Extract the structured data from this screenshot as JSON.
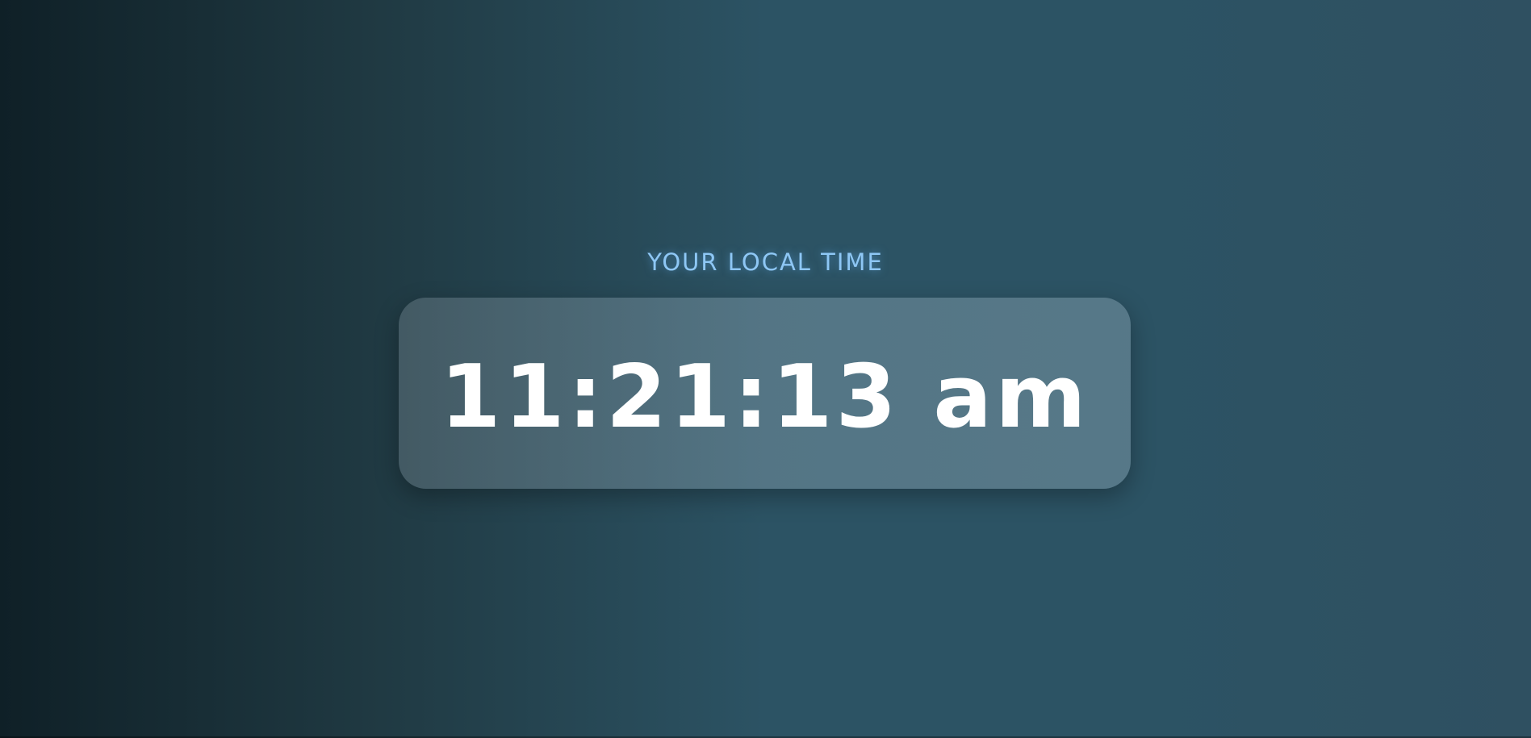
{
  "clock": {
    "label": "YOUR LOCAL TIME",
    "time": "11:21:13 am"
  },
  "colors": {
    "label": "#8ec7f5",
    "time": "#ffffff",
    "background_start": "#0f2027",
    "background_mid": "#2c5364"
  }
}
